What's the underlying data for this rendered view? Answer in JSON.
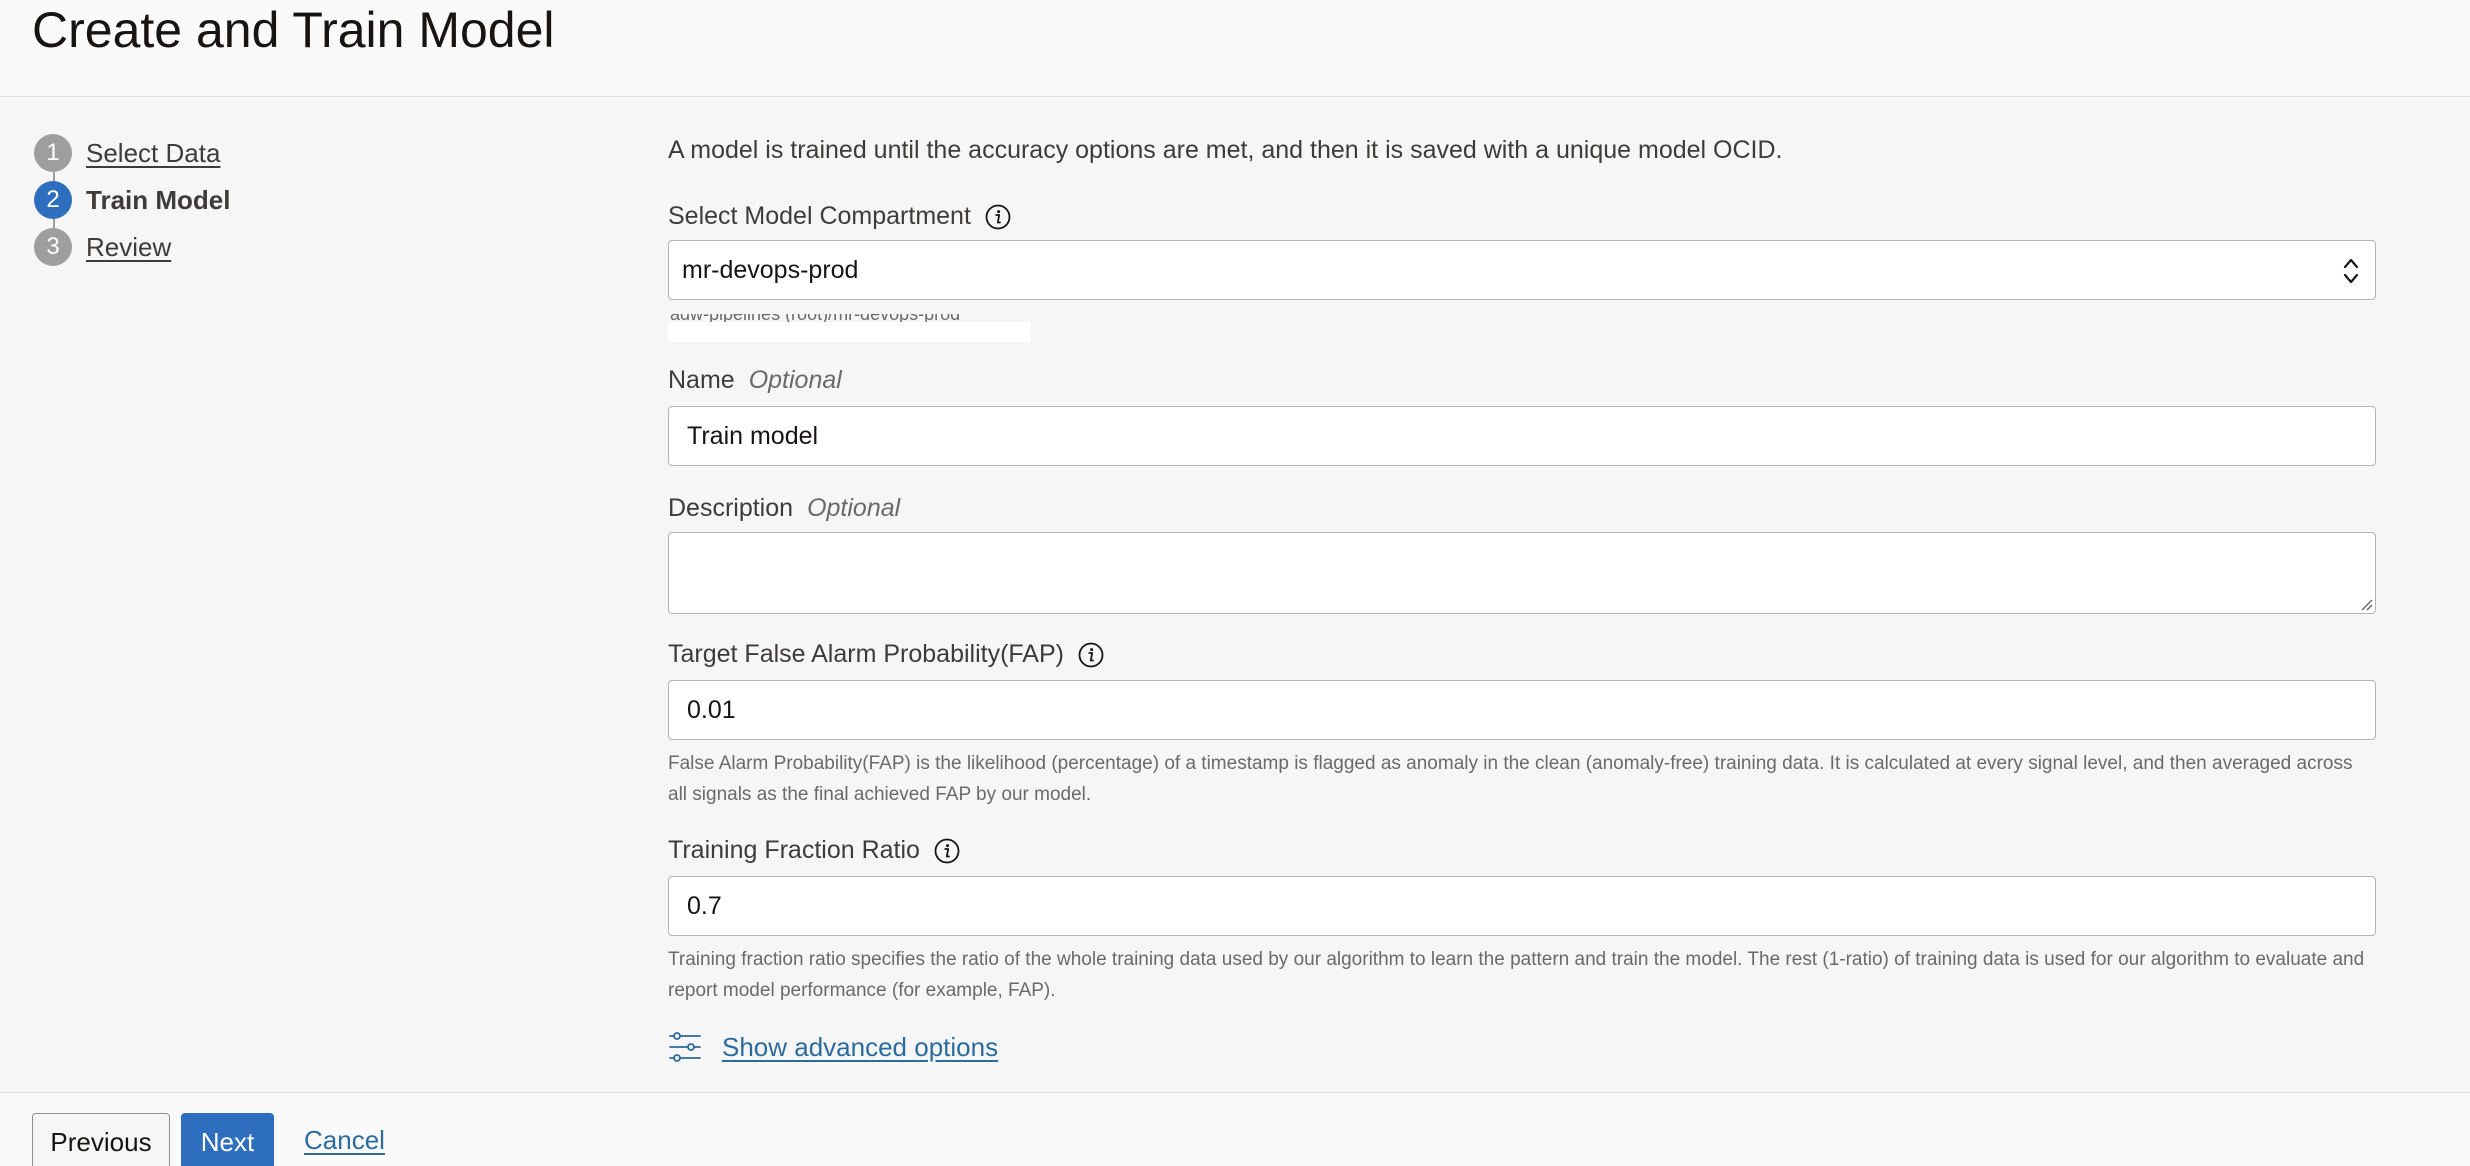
{
  "page": {
    "title": "Create and Train Model"
  },
  "steps": [
    {
      "number": "1",
      "label": "Select Data",
      "state": "link"
    },
    {
      "number": "2",
      "label": "Train Model",
      "state": "current"
    },
    {
      "number": "3",
      "label": "Review",
      "state": "link"
    }
  ],
  "form": {
    "intro": "A model is trained until the accuracy options are met, and then it is saved with a unique model OCID.",
    "compartment": {
      "label": "Select Model Compartment",
      "value": "mr-devops-prod",
      "path": "adw-pipelines (root)/mr-devops-prod",
      "icon": "info-icon"
    },
    "name": {
      "label": "Name",
      "optional": "Optional",
      "value": "Train model"
    },
    "description": {
      "label": "Description",
      "optional": "Optional",
      "value": ""
    },
    "fap": {
      "label": "Target False Alarm Probability(FAP)",
      "value": "0.01",
      "help": "False Alarm Probability(FAP) is the likelihood (percentage) of a timestamp is flagged as anomaly in the clean (anomaly-free) training data. It is calculated at every signal level, and then averaged across all signals as the final achieved FAP by our model.",
      "icon": "info-icon"
    },
    "training_fraction": {
      "label": "Training Fraction Ratio",
      "value": "0.7",
      "help": "Training fraction ratio specifies the ratio of the whole training data used by our algorithm to learn the pattern and train the model. The rest (1-ratio) of training data is used for our algorithm to evaluate and report model performance (for example, FAP).",
      "icon": "info-icon"
    },
    "advanced": {
      "label": "Show advanced options",
      "icon": "sliders-icon"
    }
  },
  "footer": {
    "previous_label": "Previous",
    "next_label": "Next",
    "cancel_label": "Cancel"
  },
  "colors": {
    "primary": "#2d6fbe",
    "link": "#2b6b9e",
    "step_inactive": "#9e9e9e",
    "background": "#f6f6f6"
  }
}
